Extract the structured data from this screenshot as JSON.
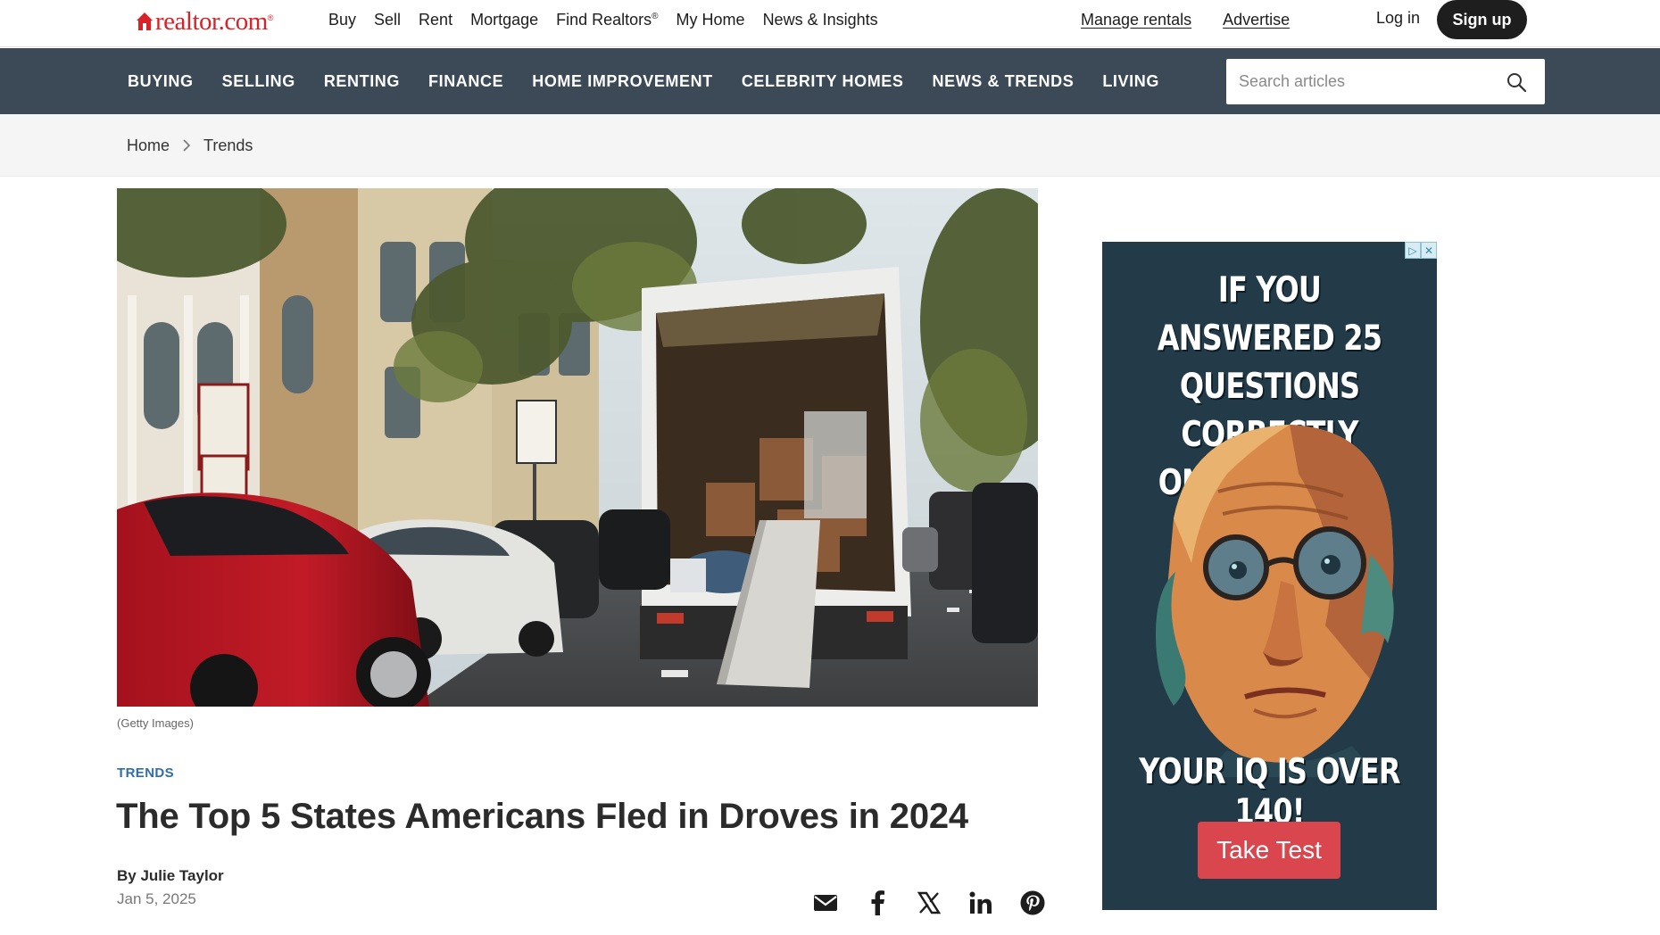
{
  "brand": {
    "name": "realtor.com",
    "mark": "®",
    "color": "#d92228"
  },
  "top_nav": [
    {
      "label": "Buy"
    },
    {
      "label": "Sell"
    },
    {
      "label": "Rent"
    },
    {
      "label": "Mortgage"
    },
    {
      "label": "Find Realtors",
      "sup": "®"
    },
    {
      "label": "My Home"
    },
    {
      "label": "News & Insights"
    }
  ],
  "top_links": {
    "manage_rentals": "Manage rentals",
    "advertise": "Advertise"
  },
  "auth": {
    "login": "Log in",
    "signup": "Sign up"
  },
  "category_nav": [
    "BUYING",
    "SELLING",
    "RENTING",
    "FINANCE",
    "HOME IMPROVEMENT",
    "CELEBRITY HOMES",
    "NEWS & TRENDS",
    "LIVING"
  ],
  "search": {
    "placeholder": "Search articles",
    "icon": "search-icon"
  },
  "breadcrumb": {
    "home": "Home",
    "current": "Trends"
  },
  "hero": {
    "caption": "(Getty Images)"
  },
  "article": {
    "tag": "TRENDS",
    "title": "The Top 5 States Americans Fled in Droves in 2024",
    "byline": "By Julie Taylor",
    "date": "Jan 5, 2025"
  },
  "share_icons": [
    "email-icon",
    "facebook-icon",
    "x-icon",
    "linkedin-icon",
    "pinterest-icon"
  ],
  "ad": {
    "headline": [
      "IF YOU ANSWERED 25",
      "QUESTIONS CORRECTLY",
      "ON THIS QUIZ,"
    ],
    "footer": "YOUR IQ IS OVER 140!",
    "cta": "Take Test",
    "controls": [
      "▷",
      "✕"
    ]
  },
  "colors": {
    "nav_bg": "#3c4a58",
    "tag": "#2f6dab",
    "ad_bg": "#233b48",
    "ad_button": "#d9464d"
  }
}
